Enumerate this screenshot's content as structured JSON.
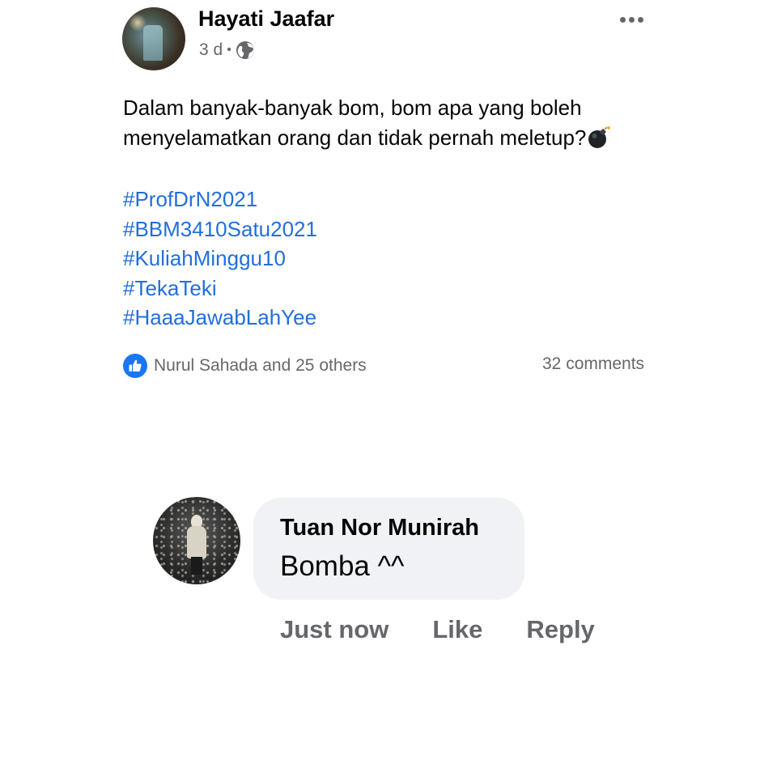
{
  "post": {
    "author": "Hayati Jaafar",
    "time": "3 d",
    "separator": "•",
    "privacy_icon": "globe-icon",
    "more_icon": "more-options-icon",
    "text_lines": [
      "Dalam banyak-banyak bom, bom apa yang boleh",
      "menyelamatkan orang dan tidak pernah meletup?"
    ],
    "emoji": "bomb-icon",
    "hashtags": [
      "#ProfDrN2021",
      "#BBM3410Satu2021",
      "#KuliahMinggu10",
      "#TekaTeki",
      "#HaaaJawabLahYee"
    ],
    "reactions_text": "Nurul Sahada and 25 others",
    "reaction_icon": "like-icon",
    "comments_count": "32 comments"
  },
  "comment": {
    "author": "Tuan Nor Munirah",
    "text": "Bomba ^^",
    "timestamp": "Just now",
    "like_label": "Like",
    "reply_label": "Reply"
  },
  "colors": {
    "hashtag": "#216fdb",
    "like_blue": "#1877f2",
    "secondary_text": "#65676b",
    "bubble_bg": "#f0f2f5"
  }
}
